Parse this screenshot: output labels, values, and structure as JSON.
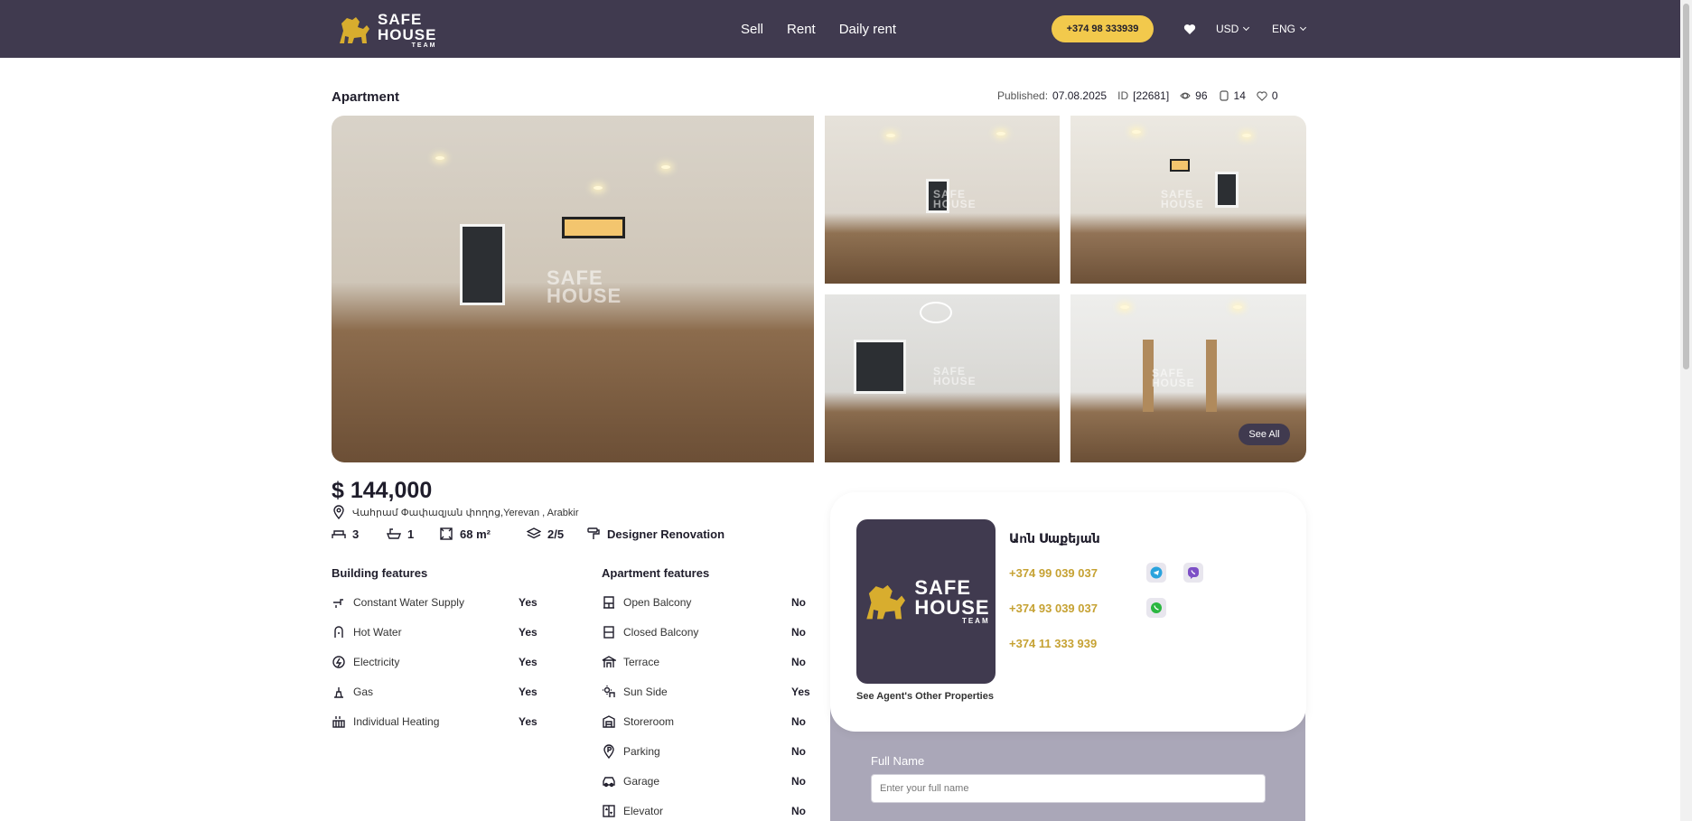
{
  "header": {
    "logo": {
      "line1": "SAFE",
      "line2": "HOUSE",
      "line3": "TEAM"
    },
    "nav": [
      {
        "label": "Sell"
      },
      {
        "label": "Rent"
      },
      {
        "label": "Daily rent"
      }
    ],
    "phone_button": "+374 98 333939",
    "currency": "USD",
    "language": "ENG"
  },
  "listing": {
    "title": "Apartment",
    "published_label": "Published:",
    "published_date": "07.08.2025",
    "id_label": "ID",
    "id_value": "[22681]",
    "views": "96",
    "calls": "14",
    "favorites": "0",
    "see_all": "See All",
    "price": "$ 144,000",
    "address": "Վահրամ Փափազյան փողոց,Yerevan , Arabkir",
    "specs": {
      "rooms": "3",
      "bathrooms": "1",
      "area": "68 m²",
      "floor": "2/5",
      "renovation": "Designer Renovation"
    }
  },
  "building_features": {
    "heading": "Building features",
    "items": [
      {
        "label": "Constant Water Supply",
        "value": "Yes",
        "icon": "faucet-icon"
      },
      {
        "label": "Hot Water",
        "value": "Yes",
        "icon": "hot-water-icon"
      },
      {
        "label": "Electricity",
        "value": "Yes",
        "icon": "electricity-icon"
      },
      {
        "label": "Gas",
        "value": "Yes",
        "icon": "gas-icon"
      },
      {
        "label": "Individual Heating",
        "value": "Yes",
        "icon": "heating-icon"
      }
    ]
  },
  "apartment_features": {
    "heading": "Apartment features",
    "items": [
      {
        "label": "Open Balcony",
        "value": "No",
        "icon": "open-balcony-icon"
      },
      {
        "label": "Closed Balcony",
        "value": "No",
        "icon": "closed-balcony-icon"
      },
      {
        "label": "Terrace",
        "value": "No",
        "icon": "terrace-icon"
      },
      {
        "label": "Sun Side",
        "value": "Yes",
        "icon": "sun-side-icon"
      },
      {
        "label": "Storeroom",
        "value": "No",
        "icon": "storeroom-icon"
      },
      {
        "label": "Parking",
        "value": "No",
        "icon": "parking-icon"
      },
      {
        "label": "Garage",
        "value": "No",
        "icon": "garage-icon"
      },
      {
        "label": "Elevator",
        "value": "No",
        "icon": "elevator-icon"
      }
    ]
  },
  "agent": {
    "name": "Աnն Սաքեյան",
    "phones": [
      "+374 99 039 037",
      "+374 93 039 037",
      "+374 11 333 939"
    ],
    "see_other": "See Agent's Other Properties",
    "logo": {
      "line1": "SAFE",
      "line2": "HOUSE",
      "line3": "TEAM"
    }
  },
  "contact_form": {
    "full_name_label": "Full Name",
    "full_name_placeholder": "Enter your full name"
  },
  "colors": {
    "header_bg": "#403a4f",
    "accent_yellow": "#f2c94c",
    "phone_gold": "#c6a233",
    "form_bg": "#aaa7b8"
  }
}
